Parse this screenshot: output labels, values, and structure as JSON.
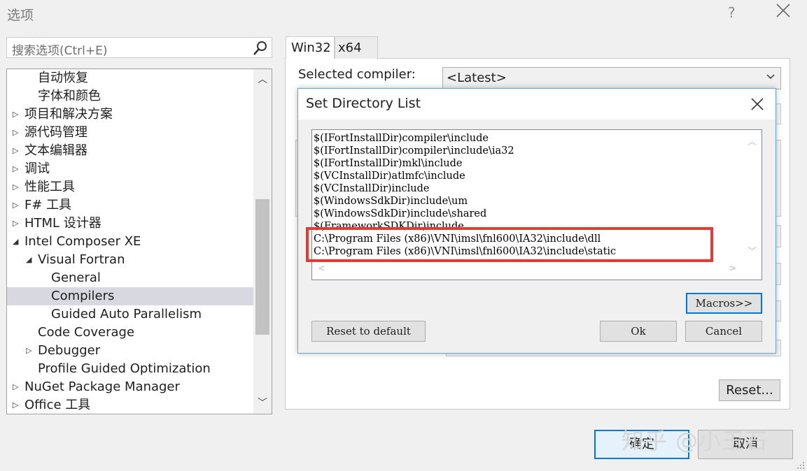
{
  "window": {
    "title": "选项",
    "help": "?"
  },
  "search": {
    "placeholder": "搜索选项(Ctrl+E)"
  },
  "tree": {
    "items": [
      {
        "label": "自动恢复",
        "expander": ""
      },
      {
        "label": "字体和颜色",
        "expander": ""
      },
      {
        "label": "项目和解决方案",
        "expander": "▷"
      },
      {
        "label": "源代码管理",
        "expander": "▷"
      },
      {
        "label": "文本编辑器",
        "expander": "▷"
      },
      {
        "label": "调试",
        "expander": "▷"
      },
      {
        "label": "性能工具",
        "expander": "▷"
      },
      {
        "label": "F# 工具",
        "expander": "▷"
      },
      {
        "label": "HTML 设计器",
        "expander": "▷"
      },
      {
        "label": "Intel Composer XE",
        "expander": "◢"
      },
      {
        "label": "Visual Fortran",
        "expander": "◢"
      },
      {
        "label": "General",
        "expander": ""
      },
      {
        "label": "Compilers",
        "expander": "",
        "selected": true
      },
      {
        "label": "Guided Auto Parallelism",
        "expander": ""
      },
      {
        "label": "Code Coverage",
        "expander": ""
      },
      {
        "label": "Debugger",
        "expander": "▷"
      },
      {
        "label": "Profile Guided Optimization",
        "expander": ""
      },
      {
        "label": "NuGet Package Manager",
        "expander": "▷"
      },
      {
        "label": "Office 工具",
        "expander": "▷"
      }
    ]
  },
  "tabs": [
    {
      "label": "Win32",
      "active": true
    },
    {
      "label": "x64",
      "active": false
    }
  ],
  "compiler": {
    "label": "Selected compiler:",
    "value": "<Latest>"
  },
  "reset_button": "Reset...",
  "footer": {
    "ok": "确定",
    "cancel": "取消"
  },
  "watermark": "知乎 @小玉石",
  "dialog": {
    "title": "Set Directory List",
    "lines": [
      "$(IFortInstallDir)compiler\\include",
      "$(IFortInstallDir)compiler\\include\\ia32",
      "$(IFortInstallDir)mkl\\include",
      "$(VCInstallDir)atlmfc\\include",
      "$(VCInstallDir)include",
      "$(WindowsSdkDir)include\\um",
      "$(WindowsSdkDir)include\\shared",
      "$(FrameworkSDKDir)include",
      "C:\\Program Files (x86)\\VNI\\imsl\\fnl600\\IA32\\include\\dll",
      "C:\\Program Files (x86)\\VNI\\imsl\\fnl600\\IA32\\include\\static"
    ],
    "macros": "Macros>>",
    "reset_default": "Reset to default",
    "ok": "Ok",
    "cancel": "Cancel"
  },
  "colors": {
    "highlight_border": "#e53935",
    "accent": "#0078d7"
  }
}
